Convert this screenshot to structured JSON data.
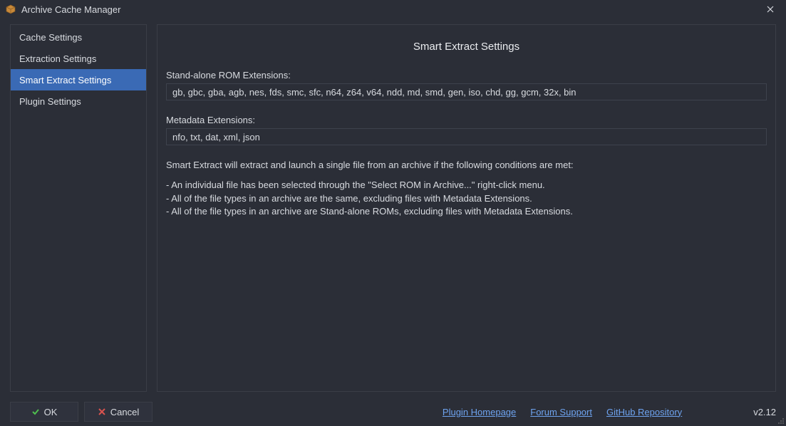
{
  "window": {
    "title": "Archive Cache Manager"
  },
  "sidebar": {
    "items": [
      {
        "label": "Cache Settings",
        "selected": false
      },
      {
        "label": "Extraction Settings",
        "selected": false
      },
      {
        "label": "Smart Extract Settings",
        "selected": true
      },
      {
        "label": "Plugin Settings",
        "selected": false
      }
    ]
  },
  "content": {
    "title": "Smart Extract Settings",
    "rom_ext_label": "Stand-alone ROM Extensions:",
    "rom_ext_value": "gb, gbc, gba, agb, nes, fds, smc, sfc, n64, z64, v64, ndd, md, smd, gen, iso, chd, gg, gcm, 32x, bin",
    "meta_ext_label": "Metadata Extensions:",
    "meta_ext_value": "nfo, txt, dat, xml, json",
    "desc_intro": "Smart Extract will extract and launch a single file from an archive if the following conditions are met:",
    "desc_b1": "- An individual file has been selected through the \"Select ROM in Archive...\" right-click menu.",
    "desc_b2": "- All of the file types in an archive are the same, excluding files with Metadata Extensions.",
    "desc_b3": "- All of the file types in an archive are Stand-alone ROMs, excluding files with Metadata Extensions."
  },
  "footer": {
    "ok_label": "OK",
    "cancel_label": "Cancel",
    "link_homepage": "Plugin Homepage",
    "link_forum": "Forum Support",
    "link_github": "GitHub Repository",
    "version": "v2.12"
  }
}
